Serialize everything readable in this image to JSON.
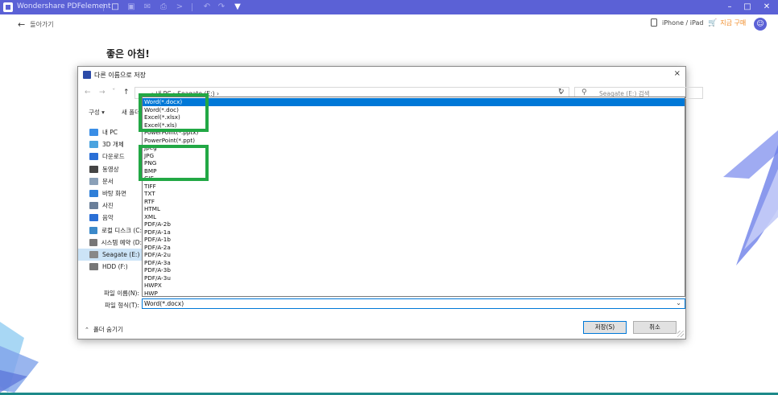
{
  "app": {
    "title": "Wondershare PDFelement",
    "accent": "#5b61d6"
  },
  "toolbar_icons": [
    "folder-icon",
    "save-icon",
    "mail-icon",
    "print-icon",
    "forward-icon",
    "undo-icon",
    "redo-icon",
    "dropdown-icon"
  ],
  "header": {
    "back_label": "돌아가기",
    "device_label": "iPhone / iPad",
    "buy_label": "지금 구매",
    "greeting": "좋은 아침!"
  },
  "dialog": {
    "title": "다른 이름으로 저장",
    "close_symbol": "×",
    "path_text": "› 내 PC  ›  Seagate (E:)  ›",
    "search_placeholder": "Seagate (E:) 검색",
    "organize_label": "구성 ▾",
    "new_folder_label": "새 폴더",
    "nav_items": [
      {
        "label": "내 PC",
        "color": "#3a8ee6"
      },
      {
        "label": "3D 개체",
        "color": "#4aa3df"
      },
      {
        "label": "다운로드",
        "color": "#2a6fd6"
      },
      {
        "label": "동영상",
        "color": "#444444"
      },
      {
        "label": "문서",
        "color": "#8aa0b8"
      },
      {
        "label": "바탕 화면",
        "color": "#2f7fd8"
      },
      {
        "label": "사진",
        "color": "#6a7f99"
      },
      {
        "label": "음악",
        "color": "#2a6fd6"
      },
      {
        "label": "로컬 디스크 (C:)",
        "color": "#3c89c9"
      },
      {
        "label": "시스템 예약 (D:)",
        "color": "#777777"
      },
      {
        "label": "Seagate (E:)",
        "color": "#888888"
      },
      {
        "label": "HDD (F:)",
        "color": "#777777"
      }
    ],
    "selected_nav": "Seagate (E:)",
    "formats": [
      "Word(*.docx)",
      "Word(*.doc)",
      "Excel(*.xlsx)",
      "Excel(*.xls)",
      "PowerPoint(*.pptx)",
      "PowerPoint(*.ppt)",
      "Jpeg",
      "JPG",
      "PNG",
      "BMP",
      "GIF",
      "TIFF",
      "TXT",
      "RTF",
      "HTML",
      "XML",
      "PDF/A-2b",
      "PDF/A-1a",
      "PDF/A-1b",
      "PDF/A-2a",
      "PDF/A-2u",
      "PDF/A-3a",
      "PDF/A-3b",
      "PDF/A-3u",
      "HWPX",
      "HWP"
    ],
    "selected_format": "Word(*.docx)",
    "filename_label": "파일 이름(N):",
    "filetype_label": "파일 형식(T):",
    "filetype_value": "Word(*.docx)",
    "hide_folders_label": "폴더 숨기기",
    "save_label": "저장(S)",
    "cancel_label": "취소"
  },
  "highlight_color": "#22a845"
}
